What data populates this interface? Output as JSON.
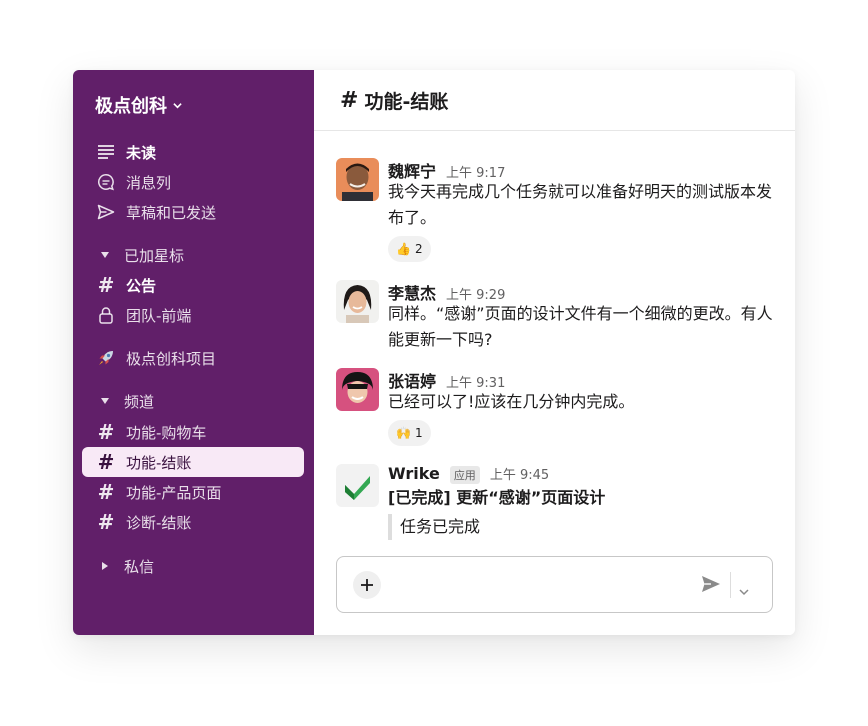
{
  "workspace": {
    "name": "极点创科"
  },
  "sidebar": {
    "top_items": [
      {
        "label": "未读",
        "icon": "unread-lines-icon"
      },
      {
        "label": "消息列",
        "icon": "threads-icon"
      },
      {
        "label": "草稿和已发送",
        "icon": "send-icon"
      }
    ],
    "starred": {
      "title": "已加星标",
      "items": [
        {
          "label": "公告"
        },
        {
          "label": "团队-前端"
        }
      ]
    },
    "project": {
      "label": "极点创科项目",
      "icon": "rocket-icon"
    },
    "channels": {
      "title": "频道",
      "items": [
        {
          "label": "功能-购物车"
        },
        {
          "label": "功能-结账"
        },
        {
          "label": "功能-产品页面"
        },
        {
          "label": "诊断-结账"
        }
      ]
    },
    "dms": {
      "title": "私信"
    }
  },
  "channel": {
    "hash": "#",
    "name": "功能-结账"
  },
  "messages": [
    {
      "author": "魏辉宁",
      "time": "上午 9:17",
      "text": "我今天再完成几个任务就可以准备好明天的测试版本发布了。",
      "reaction": {
        "emoji": "👍",
        "count": "2"
      }
    },
    {
      "author": "李慧杰",
      "time": "上午 9:29",
      "text": "同样。“感谢”页面的设计文件有一个细微的更改。有人能更新一下吗?"
    },
    {
      "author": "张语婷",
      "time": "上午 9:31",
      "text": "已经可以了!应该在几分钟内完成。",
      "reaction": {
        "emoji": "🙌",
        "count": "1"
      }
    },
    {
      "author": "Wrike",
      "tag": "应用",
      "time": "上午 9:45",
      "title": "[已完成] 更新“感谢”页面设计",
      "quote": "任务已完成"
    }
  ],
  "colors": {
    "sidebar": "#611f69",
    "active_row": "#f8e9f6",
    "wrike_check": "#34a853"
  }
}
